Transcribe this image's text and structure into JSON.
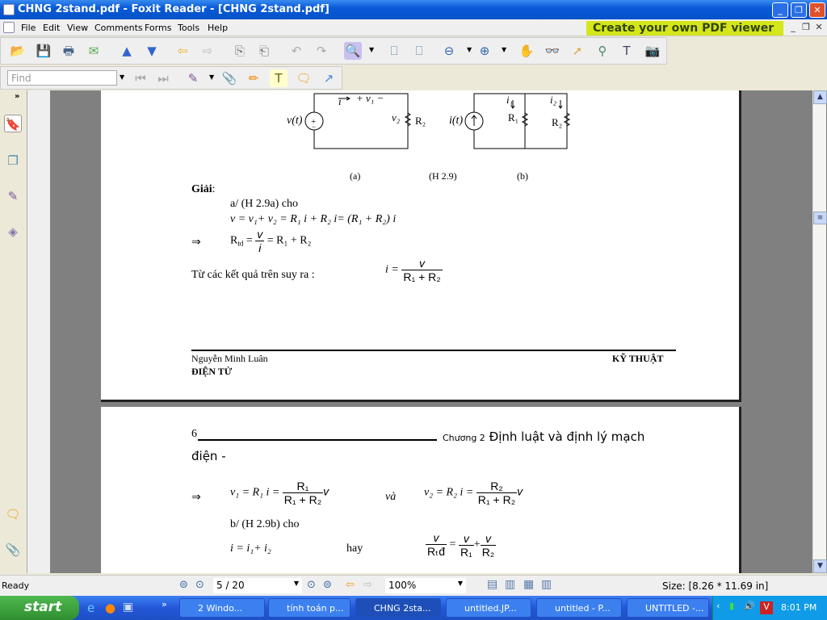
{
  "window": {
    "title": "CHNG 2stand.pdf - Foxit Reader - [CHNG 2stand.pdf]"
  },
  "menu": [
    "File",
    "Edit",
    "View",
    "Comments",
    "Forms",
    "Tools",
    "Help"
  ],
  "promo": "Create your own PDF viewer",
  "find": {
    "placeholder": "Find"
  },
  "page1": {
    "fig": {
      "v_src": "v(t)",
      "i_arrow": "i",
      "v1": "+ v₁ −",
      "v2": "v₂",
      "r2a": "R₂",
      "i_src": "i(t)",
      "i1": "i₁",
      "i2": "i₂",
      "r1b": "R₁",
      "r2b": "R₂",
      "cap_a": "(a)",
      "cap_main": "(H 2.9)",
      "cap_b": "(b)"
    },
    "giai": "Giải",
    "line_a": "a/ (H 2.9a) cho",
    "eq1": "v = v₁+ v₂ = R₁ i + R₂ i= (R₁ + R₂) i",
    "arrow": "⇒",
    "rtd": "R",
    "rtd_sub": "td",
    "eq2_num": "v",
    "eq2_den": "i",
    "eq2_rhs": "= R₁ + R₂",
    "tu_cac": "Từ các kết quả trên suy ra :",
    "eq3_lhs": "i =",
    "eq3_num": "v",
    "eq3_den": "R₁ + R₂",
    "footer_left": "Nguyễn Minh Luân",
    "footer_right": "KỸ THUẬT",
    "footer_left2": "ĐIỆN TỬ"
  },
  "page2": {
    "page_no": "6",
    "chapter_small": "Chương 2",
    "chapter": "Định luật và định lý mạch",
    "chapter2": "điện  -",
    "arrow": "⇒",
    "eq_v1": "v₁ = R₁ i =",
    "f1_num": "R₁",
    "f1_den": "R₁ + R₂",
    "v": "v",
    "va": "và",
    "eq_v2": "v₂ = R₂ i =",
    "f2_num": "R₂",
    "f2_den": "R₁ + R₂",
    "line_b": "b/ (H 2.9b) cho",
    "eq_i": "i = i₁+ i₂",
    "hay": "hay",
    "g_num": "v",
    "g_den": "Rₜđ",
    "g_d1": "R₁",
    "g_d2": "R₂"
  },
  "status": {
    "ready": "Ready",
    "page": "5 / 20",
    "zoom": "100%",
    "size": "Size: [8.26 * 11.69 in]"
  },
  "taskbar": {
    "start": "start",
    "tasks": [
      "2 Windo...",
      "tính toán p...",
      "CHNG 2sta...",
      "untitled.JP...",
      "untitled - P...",
      "UNTITLED -..."
    ],
    "time": "8:01 PM"
  }
}
